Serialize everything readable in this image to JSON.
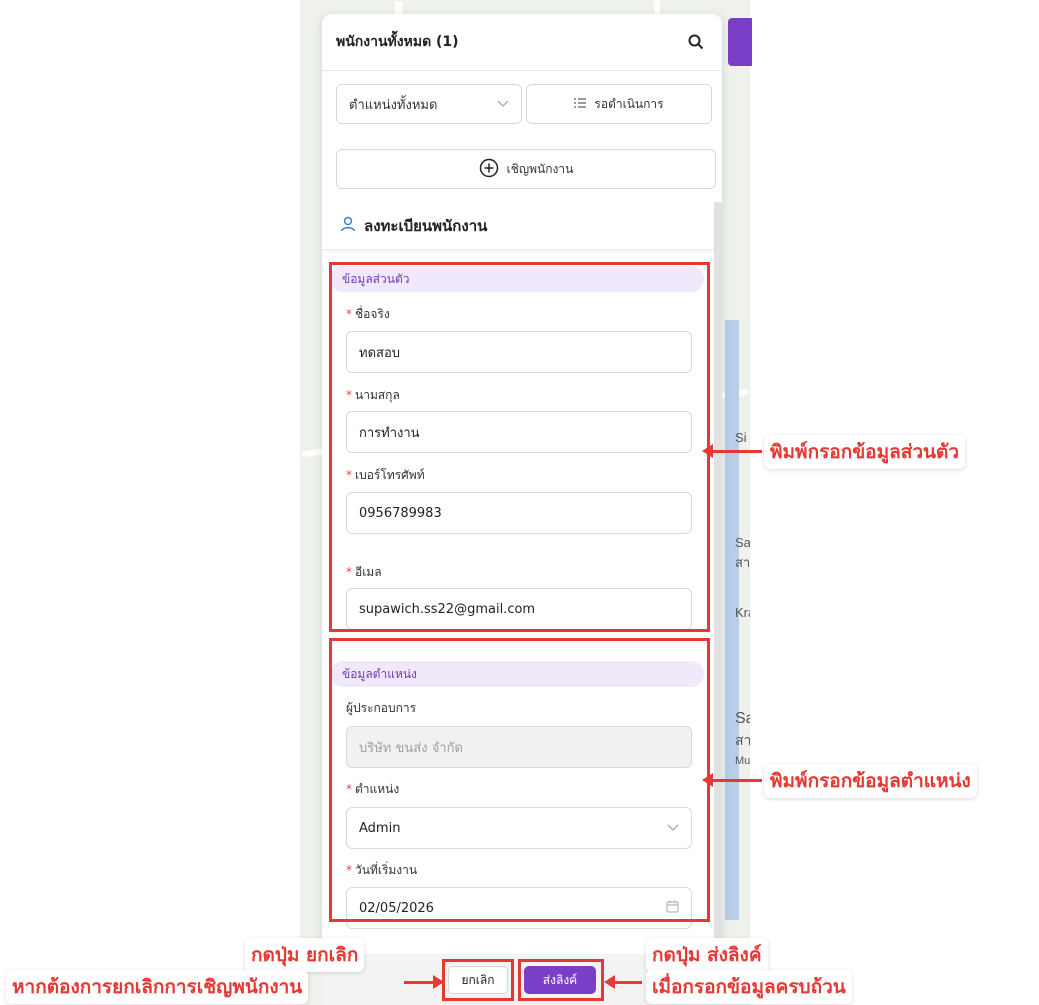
{
  "header": {
    "title": "พนักงานทั้งหมด (1)",
    "search_icon": "search-icon"
  },
  "filters": {
    "position_select": "ตำแหน่งทั้งหมด",
    "pending_button": "รอดำเนินการ"
  },
  "invite_button": "เชิญพนักงาน",
  "form": {
    "title": "ลงทะเบียนพนักงาน",
    "personal_section": "ข้อมูลส่วนตัว",
    "first_name_label": "ชื่อจริง",
    "first_name_value": "ทดสอบ",
    "last_name_label": "นามสกุล",
    "last_name_value": "การทำงาน",
    "phone_label": "เบอร์โทรศัพท์",
    "phone_value": "0956789983",
    "email_label": "อีเมล",
    "email_value": "supawich.ss22@gmail.com",
    "position_section": "ข้อมูลตำแหน่ง",
    "operator_label": "ผู้ประกอบการ",
    "operator_value": "บริษัท ขนส่ง จำกัด",
    "position_label": "ตำแหน่ง",
    "position_value": "Admin",
    "start_date_label": "วันที่เริ่มงาน",
    "start_date_value": "02/05/2026"
  },
  "actions": {
    "cancel": "ยกเลิก",
    "send_link": "ส่งลิงค์"
  },
  "annotations": {
    "personal": "พิมพ์กรอกข้อมูลส่วนตัว",
    "position": "พิมพ์กรอกข้อมูลตำแหน่ง",
    "cancel_line1": "กดปุ่ม ยกเลิก",
    "cancel_line2": "หากต้องการยกเลิกการเชิญพนักงาน",
    "send_line1": "กดปุ่ม ส่งลิงค์",
    "send_line2": "เมื่อกรอกข้อมูลครบถ้วน"
  },
  "map_labels": [
    "Si",
    "Sam",
    "สา",
    "Kra",
    "Sal",
    "สา",
    "Mue"
  ],
  "colors": {
    "accent": "#7a3fc7",
    "highlight": "#e53935"
  }
}
